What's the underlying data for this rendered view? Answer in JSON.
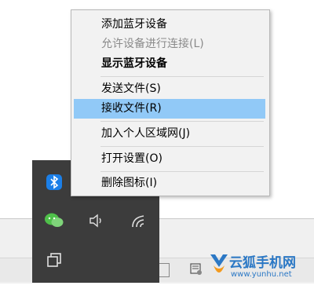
{
  "context_menu": {
    "items": [
      {
        "label": "添加蓝牙设备"
      },
      {
        "label": "允许设备进行连接(L)"
      },
      {
        "label": "显示蓝牙设备"
      },
      {
        "label": "发送文件(S)"
      },
      {
        "label": "接收文件(R)"
      },
      {
        "label": "加入个人区域网(J)"
      },
      {
        "label": "打开设置(O)"
      },
      {
        "label": "删除图标(I)"
      }
    ]
  },
  "tray": {
    "icons": [
      "bluetooth-icon",
      "wechat-icon",
      "volume-icon",
      "wifi-icon",
      "task-view-icon"
    ]
  },
  "watermark": {
    "brand": "云狐手机网",
    "url": "www.yunhu.net"
  },
  "colors": {
    "highlight": "#91c9f7",
    "tray_bg": "#3c3c3c",
    "bluetooth": "#1b7fe8",
    "wechat": "#4fc04a"
  }
}
